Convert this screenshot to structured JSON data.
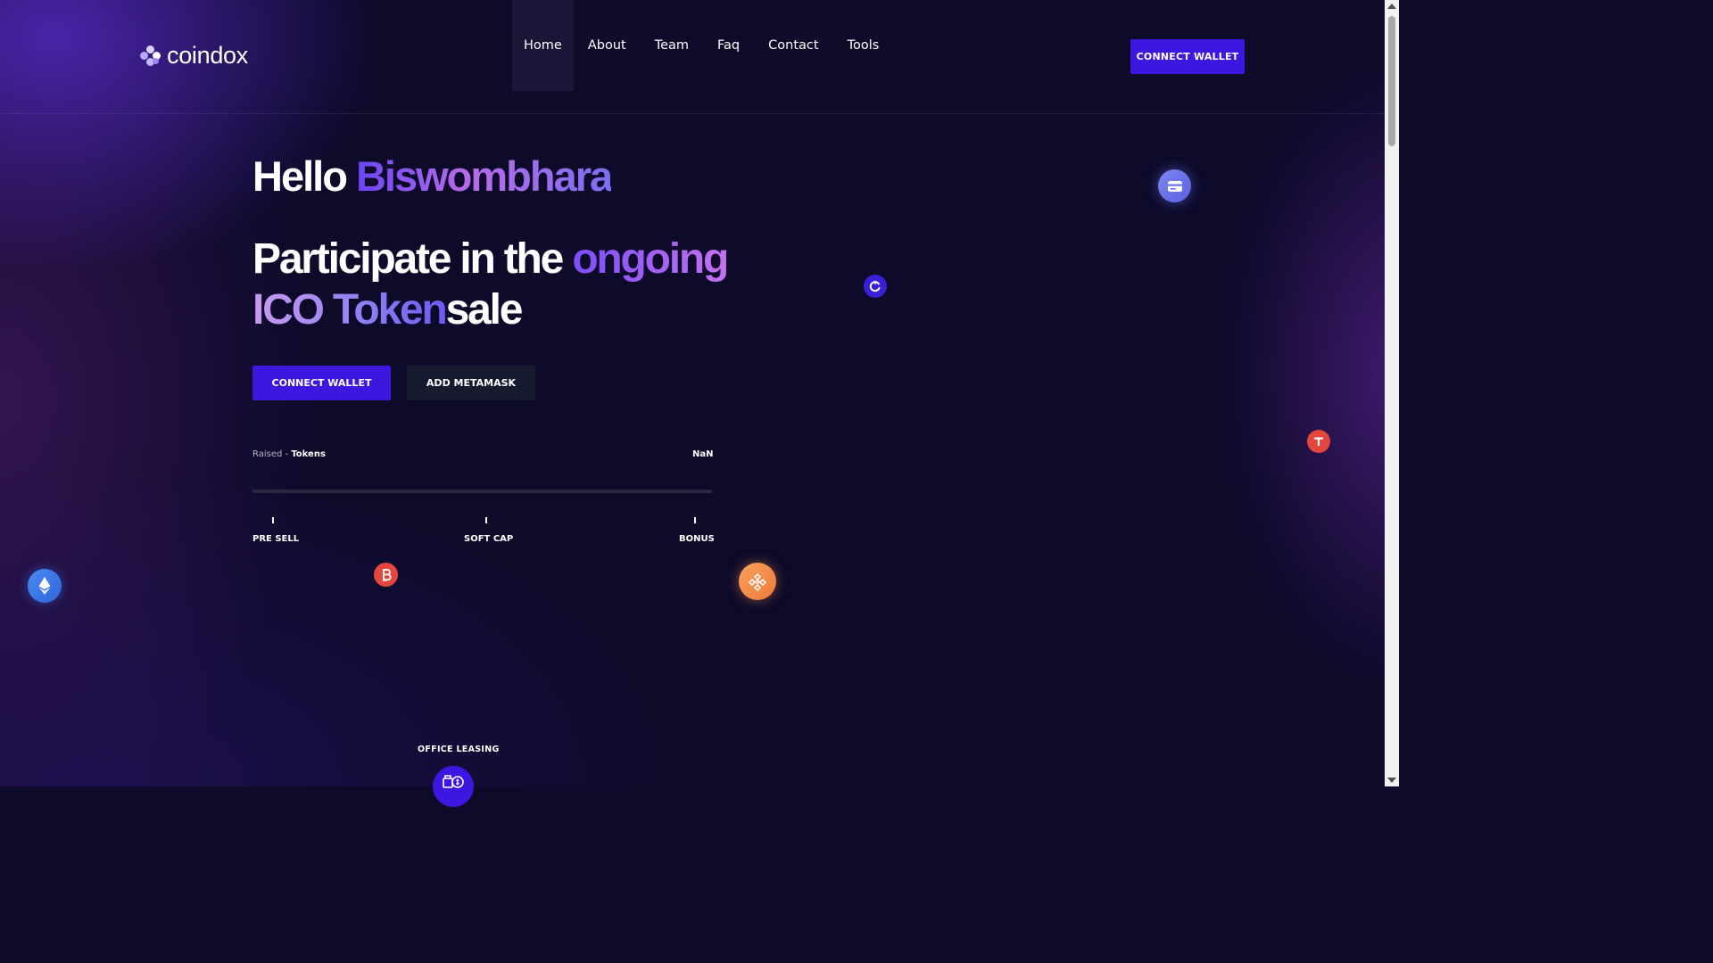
{
  "header": {
    "logo_text": "coindox",
    "nav": [
      {
        "label": "Home",
        "active": true
      },
      {
        "label": "About"
      },
      {
        "label": "Team"
      },
      {
        "label": "Faq"
      },
      {
        "label": "Contact"
      },
      {
        "label": "Tools"
      }
    ],
    "connect_wallet_label": "CONNECT WALLET"
  },
  "hero": {
    "greeting": "Hello",
    "user_name": "Biswombhara",
    "headline_part1": "Participate in the ",
    "headline_highlight1": "ongoing",
    "headline_highlight2": "ICO Token",
    "headline_part2": "sale",
    "connect_wallet_label": "CONNECT WALLET",
    "add_metamask_label": "ADD METAMASK"
  },
  "progress": {
    "raised_label": "Raised - ",
    "raised_unit": "Tokens",
    "value_text": "NaN",
    "fill_fraction": 0
  },
  "milestones": [
    "PRE SELL",
    "SOFT CAP",
    "BONUS"
  ],
  "section_label": "OFFICE LEASING",
  "colors": {
    "accent": "#3d16e0",
    "background": "#0d0a2a",
    "bitcoin": "#e5473f",
    "binance": "#f28a4a",
    "ethereum": "#3d7ef0",
    "tether": "#e2463d"
  },
  "icons": [
    "card-coin-icon",
    "cycle-coin-icon",
    "tether-coin-icon",
    "ethereum-coin-icon",
    "bitcoin-coin-icon",
    "binance-coin-icon",
    "office-leasing-icon"
  ]
}
